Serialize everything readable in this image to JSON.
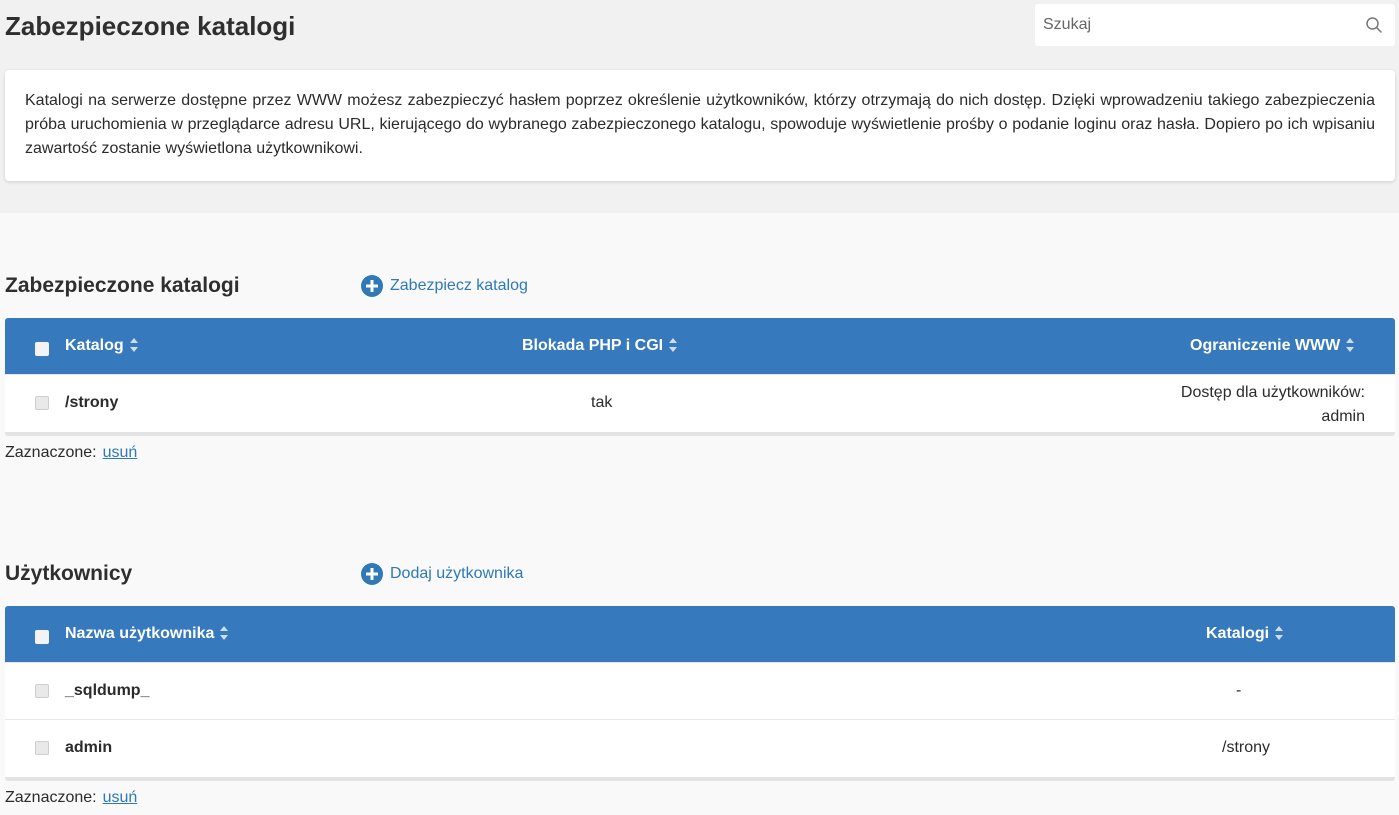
{
  "header": {
    "title": "Zabezpieczone katalogi",
    "search_placeholder": "Szukaj"
  },
  "info": {
    "text": "Katalogi na serwerze dostępne przez WWW możesz zabezpieczyć hasłem poprzez określenie użytkowników, którzy otrzymają do nich dostęp. Dzięki wprowadzeniu takiego zabezpieczenia próba uruchomienia w przeglądarce adresu URL, kierującego do wybranego zabezpieczonego katalogu, spowoduje wyświetlenie prośby o podanie loginu oraz hasła. Dopiero po ich wpisaniu zawartość zostanie wyświetlona użytkownikowi."
  },
  "directories": {
    "title": "Zabezpieczone katalogi",
    "action_label": "Zabezpiecz katalog",
    "columns": [
      "Katalog",
      "Blokada PHP i CGI",
      "Ograniczenie WWW"
    ],
    "rows": [
      {
        "path": "/strony",
        "php_cgi_lock": "tak",
        "www_restriction_line1": "Dostęp dla użytkowników:",
        "www_restriction_line2": "admin"
      }
    ],
    "selected_label": "Zaznaczone:",
    "delete_label": "usuń"
  },
  "users": {
    "title": "Użytkownicy",
    "action_label": "Dodaj użytkownika",
    "columns": [
      "Nazwa użytkownika",
      "Katalogi"
    ],
    "rows": [
      {
        "name": "_sqldump_",
        "directories": "-"
      },
      {
        "name": "admin",
        "directories": "/strony"
      }
    ],
    "selected_label": "Zaznaczone:",
    "delete_label": "usuń"
  },
  "colors": {
    "accent": "#3679bd",
    "link": "#2f79b8"
  }
}
